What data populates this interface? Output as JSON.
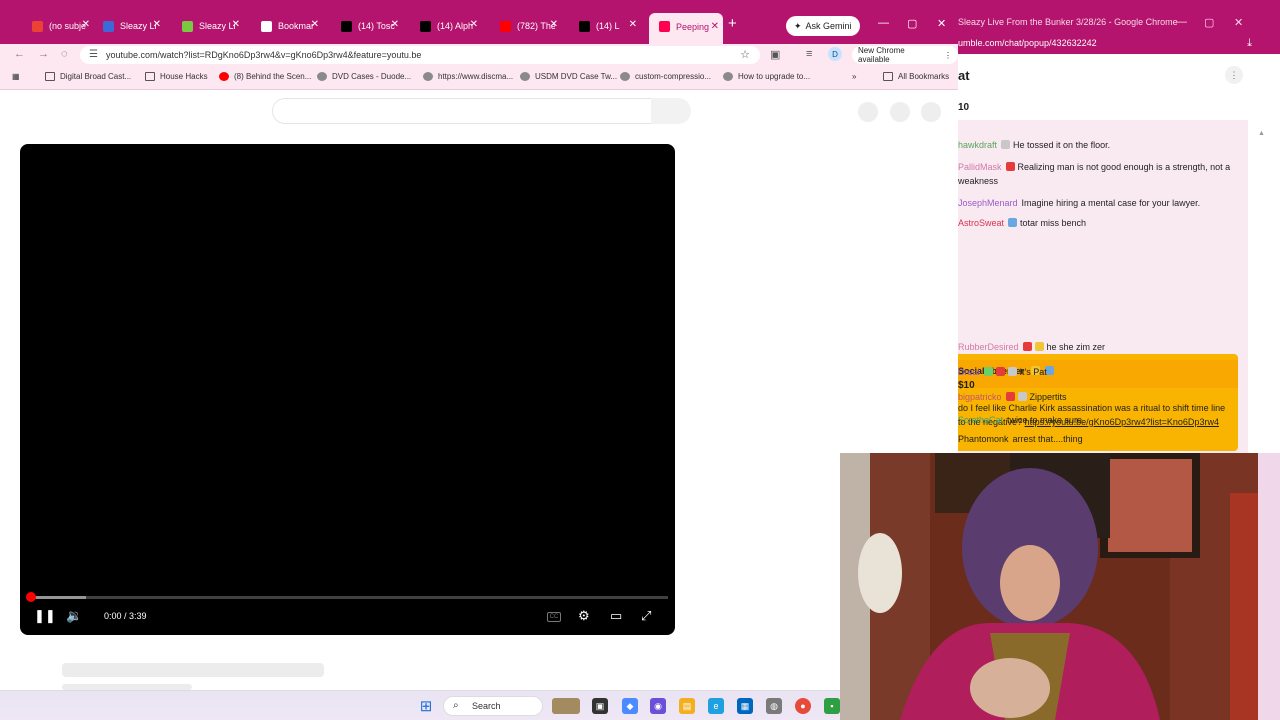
{
  "main_window": {
    "tabs": [
      {
        "title": "(no subje",
        "favicon": "gmail-icon",
        "color": "#ea4335"
      },
      {
        "title": "Sleazy Li",
        "favicon": "rumble-r-icon",
        "color": "#3b6ad8"
      },
      {
        "title": "Sleazy Li",
        "favicon": "rumble-play-icon",
        "color": "#7ac943"
      },
      {
        "title": "Bookmar",
        "favicon": "star-icon",
        "color": "#ffffff"
      },
      {
        "title": "(14) Tosc",
        "favicon": "x-icon",
        "color": "#000000"
      },
      {
        "title": "(14) Alph",
        "favicon": "x-icon",
        "color": "#000000"
      },
      {
        "title": "(782) The",
        "favicon": "youtube-icon",
        "color": "#ff0000"
      },
      {
        "title": "(14) L",
        "favicon": "x-icon",
        "color": "#000000"
      },
      {
        "title": "Peeping",
        "favicon": "rumble-icon",
        "color": "#ff0050",
        "active": true
      }
    ],
    "ask_gemini": "Ask Gemini",
    "url": "youtube.com/watch?list=RDgKno6Dp3rw4&v=gKno6Dp3rw4&feature=youtu.be",
    "profile_initial": "D",
    "new_chrome": "New Chrome available",
    "bookmarks": [
      {
        "label": "Digital Broad Cast...",
        "icon": "folder-icon"
      },
      {
        "label": "House Hacks",
        "icon": "folder-icon"
      },
      {
        "label": "(8) Behind the Scen...",
        "icon": "youtube-icon"
      },
      {
        "label": "DVD Cases - Duode...",
        "icon": "site-icon"
      },
      {
        "label": "https://www.discma...",
        "icon": "site-icon"
      },
      {
        "label": "USDM DVD Case Tw...",
        "icon": "site-icon"
      },
      {
        "label": "custom-compressio...",
        "icon": "site-icon"
      },
      {
        "label": "How to upgrade to...",
        "icon": "site-icon"
      }
    ],
    "all_bookmarks": "All Bookmarks",
    "player": {
      "time": "0:00 / 3:39",
      "buffered_fraction": 0.09,
      "cc_label": "CC"
    }
  },
  "chat_window": {
    "title": "Sleazy Live From the Bunker 3/28/26 - Google Chrome",
    "url": "umble.com/chat/popup/432632242",
    "header": "at",
    "subheader": "10",
    "messages": [
      {
        "user": "hawkdraft",
        "color": "#5aa65a",
        "badges": [
          "b-gray"
        ],
        "text": "He tossed it on the floor."
      },
      {
        "user": "PallidMask",
        "color": "#d47aa8",
        "badges": [
          "b-red"
        ],
        "text": "Realizing man is not good enough is a strength, not a weakness"
      },
      {
        "user": "JosephMenard",
        "color": "#9b5bc9",
        "badges": [],
        "text": "Imagine hiring a mental case for your lawyer."
      },
      {
        "user": "AstroSweat",
        "color": "#d8334a",
        "badges": [
          "b-blue"
        ],
        "text": "totar miss bench"
      },
      {
        "user": "RubberDesired",
        "color": "#d47aa8",
        "badges": [
          "b-red",
          "b-yel"
        ],
        "text": "he she zim zer"
      },
      {
        "user": "Dreal",
        "color": "#7a4fd0",
        "badges": [
          "b-grn",
          "b-red",
          "b-gray"
        ],
        "text": "It's Pat"
      },
      {
        "user": "bigpatricko",
        "color": "#c9546a",
        "badges": [
          "b-red",
          "b-gray"
        ],
        "text": "Zippertits"
      },
      {
        "user": "ScratheCat",
        "color": "#3aa27e",
        "badges": [],
        "text": "twice to make sure."
      },
      {
        "user": "Phantomonk",
        "color": "#1f1f1f",
        "badges": [],
        "text": "arrest that....thing"
      }
    ],
    "superchat": {
      "user": "SocialObserver",
      "amount": "$10",
      "text": "do I feel like Charlie Kirk assassination was a ritual to shift time line to the negative?",
      "link": "https://youtu.be/gKno6Dp3rw4?list=Kno6Dp3rw4"
    }
  },
  "taskbar": {
    "search": "Search"
  }
}
